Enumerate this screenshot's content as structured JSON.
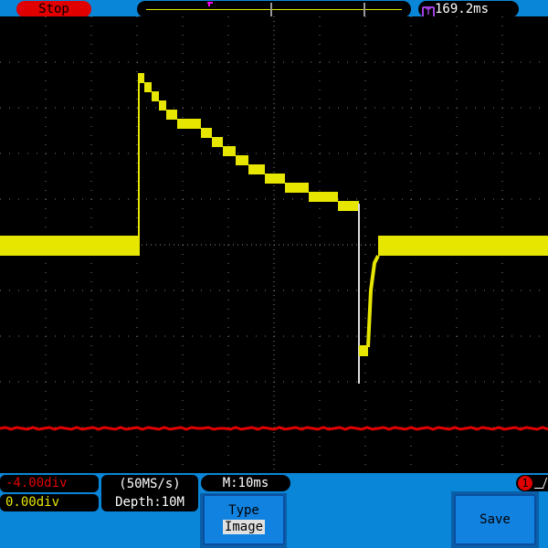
{
  "status": {
    "run_state": "Stop",
    "trigger_time": "169.2ms",
    "trigger_icon": "T"
  },
  "bottom": {
    "ch1_offset": "-4.00div",
    "ch2_offset": "0.00div",
    "sample_rate": "(50MS/s)",
    "depth": "Depth:10M",
    "timebase": "M:10ms",
    "trigger_channel": "1"
  },
  "menu": {
    "type_label": "Type",
    "type_value": "Image",
    "save_label": "Save"
  },
  "colors": {
    "ch1": "#e00000",
    "ch2": "#e6e600",
    "background": "#0a86d8"
  }
}
